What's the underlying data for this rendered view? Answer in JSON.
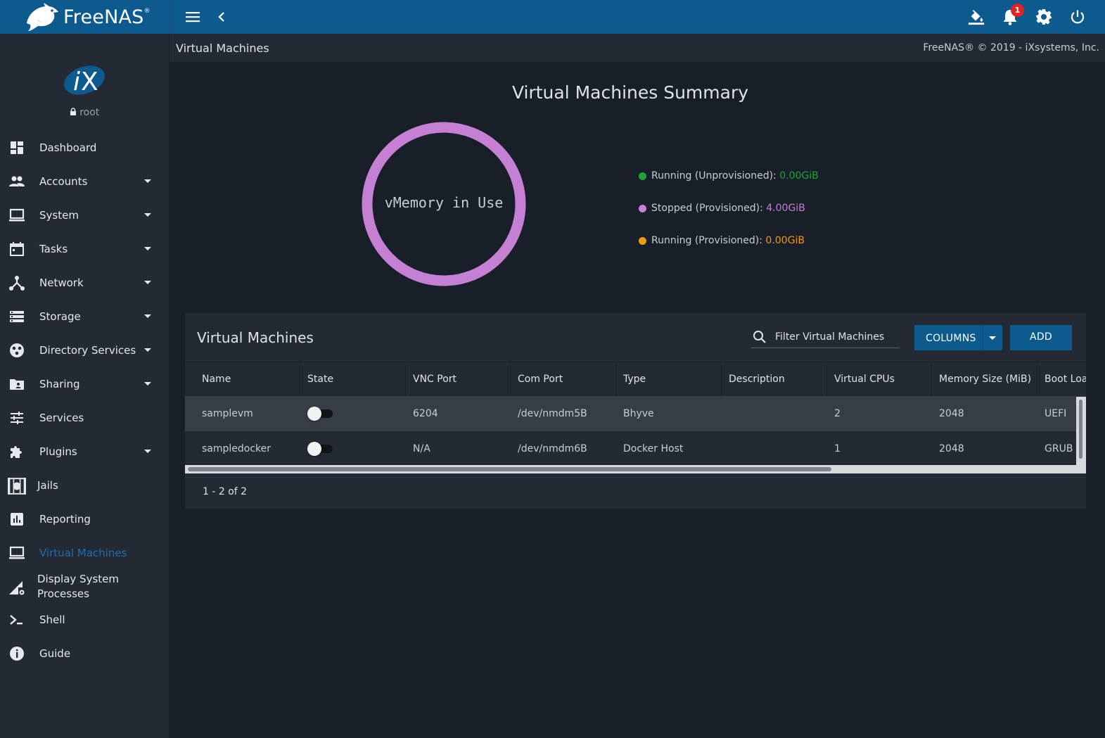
{
  "app": {
    "name": "FreeNAS",
    "trademark": "®"
  },
  "topbar": {
    "menu_icon": "hamburger-menu-icon",
    "back_icon": "chevron-left-icon",
    "theme_icon": "paint-bucket-icon",
    "notifications_icon": "bell-icon",
    "notification_count": "1",
    "settings_icon": "gear-icon",
    "power_icon": "power-icon"
  },
  "sidebar": {
    "logo": "iX",
    "user": "root",
    "items": [
      {
        "label": "Dashboard",
        "icon": "dashboard-icon",
        "has_submenu": false
      },
      {
        "label": "Accounts",
        "icon": "people-icon",
        "has_submenu": true
      },
      {
        "label": "System",
        "icon": "laptop-icon",
        "has_submenu": true
      },
      {
        "label": "Tasks",
        "icon": "calendar-icon",
        "has_submenu": true
      },
      {
        "label": "Network",
        "icon": "network-icon",
        "has_submenu": true
      },
      {
        "label": "Storage",
        "icon": "storage-icon",
        "has_submenu": true
      },
      {
        "label": "Directory Services",
        "icon": "directory-icon",
        "has_submenu": true
      },
      {
        "label": "Sharing",
        "icon": "folder-share-icon",
        "has_submenu": true
      },
      {
        "label": "Services",
        "icon": "sliders-icon",
        "has_submenu": false
      },
      {
        "label": "Plugins",
        "icon": "puzzle-icon",
        "has_submenu": true
      },
      {
        "label": "Jails",
        "icon": "jail-icon",
        "has_submenu": false
      },
      {
        "label": "Reporting",
        "icon": "bar-chart-icon",
        "has_submenu": false
      },
      {
        "label": "Virtual Machines",
        "icon": "laptop-icon",
        "has_submenu": false,
        "active": true
      },
      {
        "label": "Display System Processes",
        "line1": "Display System",
        "line2": "Processes",
        "icon": "signal-gear-icon",
        "has_submenu": false
      },
      {
        "label": "Shell",
        "icon": "terminal-icon",
        "has_submenu": false
      },
      {
        "label": "Guide",
        "icon": "info-icon",
        "has_submenu": false
      }
    ]
  },
  "header": {
    "page_title": "Virtual Machines",
    "copyright": "FreeNAS® © 2019 - iXsystems, Inc."
  },
  "summary": {
    "title": "Virtual Machines Summary",
    "donut_label": "vMemory in Use",
    "legend": [
      {
        "label": "Running (Unprovisioned): ",
        "value": "0.00GiB",
        "color": "#1ea33a"
      },
      {
        "label": "Stopped (Provisioned): ",
        "value": "4.00GiB",
        "color": "#c57fd3"
      },
      {
        "label": "Running (Provisioned): ",
        "value": "0.00GiB",
        "color": "#ef9b10"
      }
    ]
  },
  "chart_data": {
    "type": "pie",
    "title": "vMemory in Use",
    "categories": [
      "Running (Unprovisioned)",
      "Stopped (Provisioned)",
      "Running (Provisioned)"
    ],
    "values": [
      0.0,
      4.0,
      0.0
    ],
    "unit": "GiB",
    "colors": [
      "#1ea33a",
      "#c57fd3",
      "#ef9b10"
    ]
  },
  "vm_table": {
    "title": "Virtual Machines",
    "filter_placeholder": "Filter Virtual Machines",
    "search_icon": "search-icon",
    "columns_button": "COLUMNS",
    "add_button": "ADD",
    "headers": [
      "Name",
      "State",
      "VNC Port",
      "Com Port",
      "Type",
      "Description",
      "Virtual CPUs",
      "Memory Size (MiB)",
      "Boot Loader Type"
    ],
    "rows": [
      {
        "name": "samplevm",
        "state": "off",
        "vnc_port": "6204",
        "com_port": "/dev/nmdm5B",
        "type": "Bhyve",
        "description": "",
        "vcpus": "2",
        "memory": "2048",
        "boot": "UEFI"
      },
      {
        "name": "sampledocker",
        "state": "off",
        "vnc_port": "N/A",
        "com_port": "/dev/nmdm6B",
        "type": "Docker Host",
        "description": "",
        "vcpus": "1",
        "memory": "2048",
        "boot": "GRUB"
      }
    ],
    "paginator": "1 - 2 of 2"
  },
  "colors": {
    "topbar": "#0d5a8e",
    "sidebar": "#232a33",
    "background": "#181f28",
    "accent": "#0d5a8e"
  }
}
